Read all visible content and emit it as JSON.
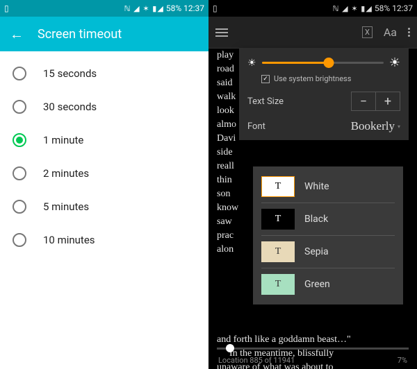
{
  "status": {
    "icons": "ℕ ◢ ✶ ▮◢",
    "battery": "58%",
    "time": "12:37",
    "left_icon": "▯"
  },
  "left": {
    "title": "Screen timeout",
    "options": [
      {
        "label": "15 seconds",
        "selected": false
      },
      {
        "label": "30 seconds",
        "selected": false
      },
      {
        "label": "1 minute",
        "selected": true
      },
      {
        "label": "2 minutes",
        "selected": false
      },
      {
        "label": "5 minutes",
        "selected": false
      },
      {
        "label": "10 minutes",
        "selected": false
      }
    ]
  },
  "right": {
    "header": {
      "aa": "Aa"
    },
    "sidewords": [
      "play",
      "road",
      "said",
      "walk",
      "look",
      "almo",
      "Davi",
      "side",
      "reall",
      "thin",
      "son",
      "know",
      "saw",
      "prac",
      "alon"
    ],
    "line_goddamn": "and forth like a goddamn beast…\"",
    "para2a": "In the meantime, blissfully",
    "para2b": "unaware of what was about to",
    "settings": {
      "brightness_pct": 55,
      "use_system": "Use system brightness",
      "use_system_checked": true,
      "textsize_label": "Text Size",
      "minus": "−",
      "plus": "+",
      "font_label": "Font",
      "font_value": "Bookerly"
    },
    "themes": [
      {
        "key": "white",
        "label": "White",
        "swatch": "T",
        "cls": "sw-white"
      },
      {
        "key": "black",
        "label": "Black",
        "swatch": "T",
        "cls": "sw-black"
      },
      {
        "key": "sepia",
        "label": "Sepia",
        "swatch": "T",
        "cls": "sw-sepia"
      },
      {
        "key": "green",
        "label": "Green",
        "swatch": "T",
        "cls": "sw-green"
      }
    ],
    "footer": {
      "location": "Location 885 of 11941",
      "percent": "7%"
    }
  }
}
